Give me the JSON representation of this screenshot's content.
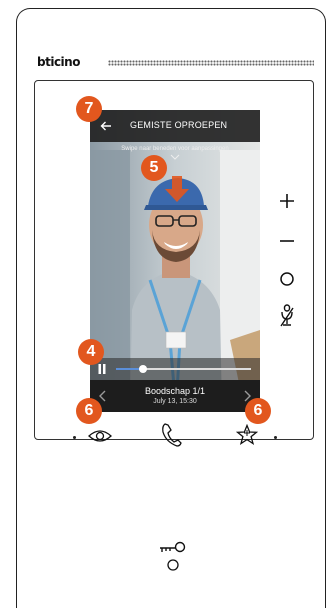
{
  "brand": {
    "name": "bticino"
  },
  "screen": {
    "title": "GEMISTE OPROEPEN",
    "hint": "Swipe naar beneden voor aanpassingen",
    "player": {
      "progress": 0.2
    },
    "message": {
      "label": "Boodschap 1/1",
      "date": "July 13, 15:30"
    }
  },
  "callouts": [
    "7",
    "5",
    "4",
    "6",
    "6"
  ],
  "side_icons": [
    "plus-icon",
    "minus-icon",
    "circle-icon",
    "mic-muted-icon"
  ],
  "bottom_icons": [
    "eye-icon",
    "phone-icon",
    "star-icon",
    "key-icon"
  ],
  "colors": {
    "callout": "#e2571e",
    "progress": "#5b8fd9",
    "bar": "#1d1d1d"
  }
}
